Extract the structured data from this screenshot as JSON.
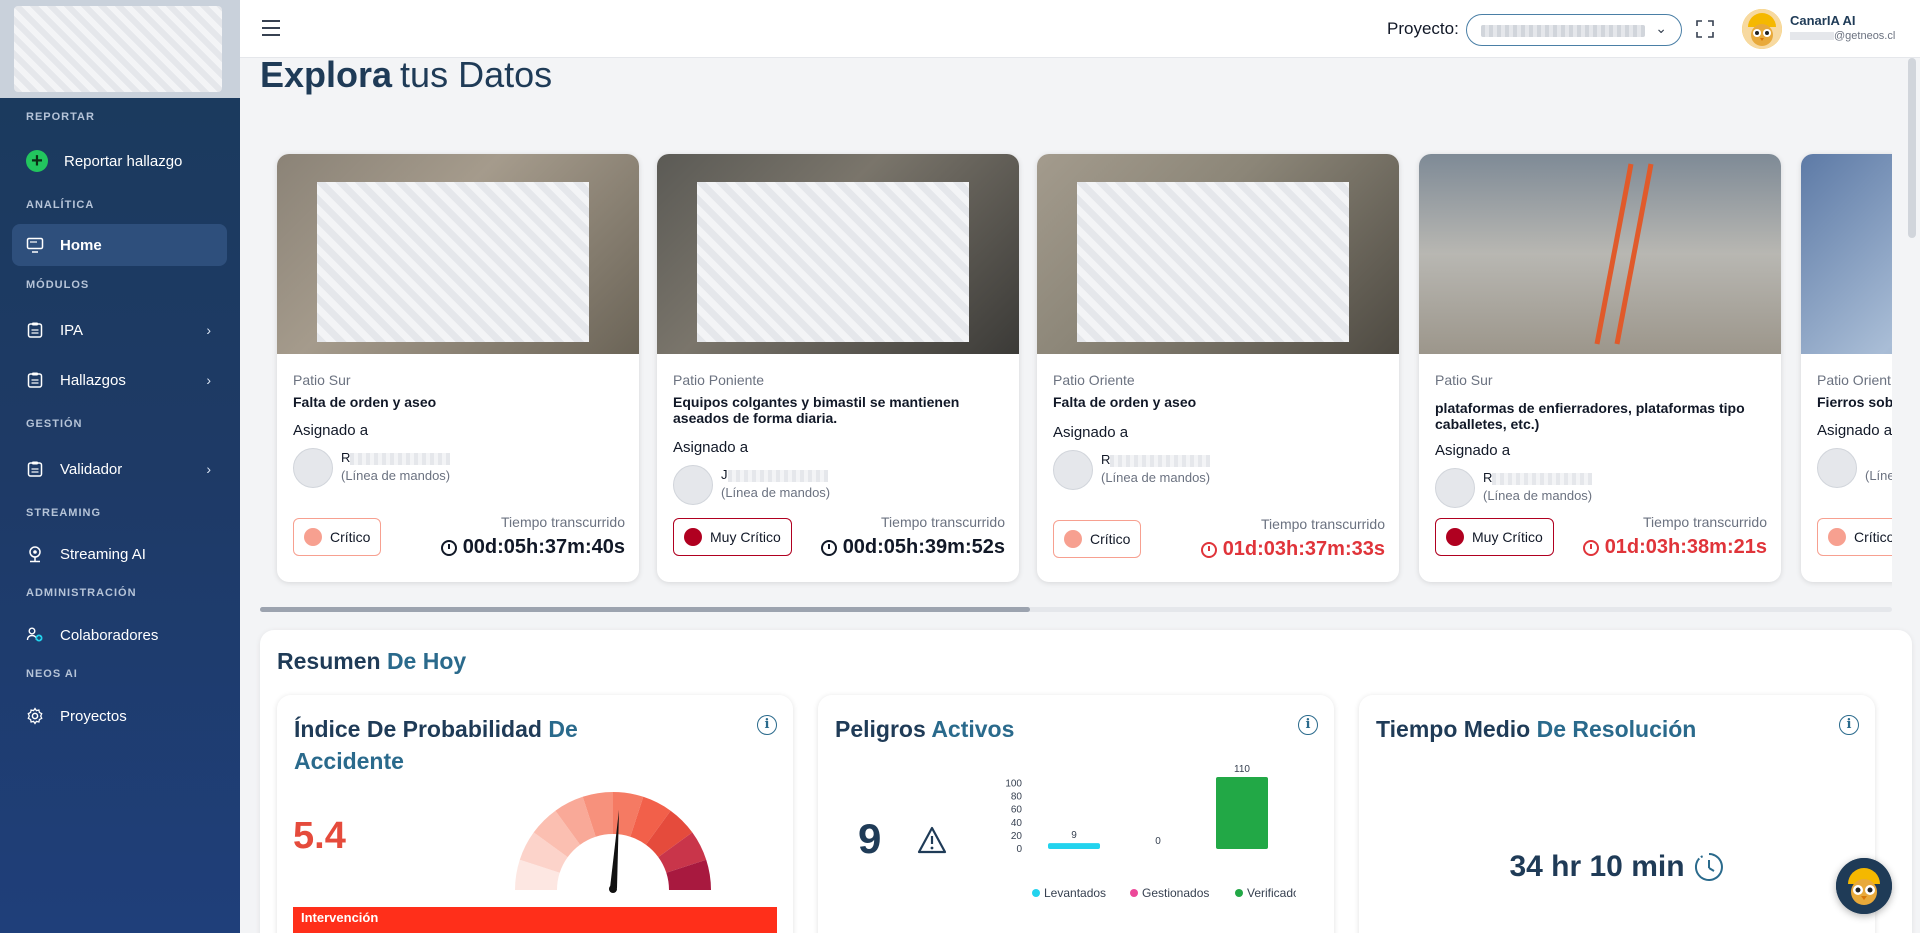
{
  "sidebar": {
    "sections": {
      "reportar": "REPORTAR",
      "analitica": "ANALÍTICA",
      "modulos": "MÓDULOS",
      "gestion": "GESTIÓN",
      "streaming": "STREAMING",
      "administracion": "ADMINISTRACIÓN",
      "neos_ai": "NEOS AI"
    },
    "items": {
      "reportar_hallazgo": "Reportar hallazgo",
      "home": "Home",
      "ipa": "IPA",
      "hallazgos": "Hallazgos",
      "validador": "Validador",
      "streaming_ai": "Streaming AI",
      "colaboradores": "Colaboradores",
      "proyectos": "Proyectos"
    }
  },
  "header": {
    "project_label": "Proyecto:",
    "user_name": "CanarIA AI",
    "user_email_suffix": "@getneos.cl"
  },
  "page": {
    "title_bold": "Explora",
    "title_rest": "tus Datos"
  },
  "cards": [
    {
      "location": "Patio Sur",
      "title": "Falta de orden y aseo",
      "assigned_label": "Asignado a",
      "person_initial": "R",
      "person_role": "(Línea de mandos)",
      "severity": "Crítico",
      "time_label": "Tiempo transcurrido",
      "time": "00d:05h:37m:40s"
    },
    {
      "location": "Patio Poniente",
      "title": "Equipos colgantes y bimastil se mantienen aseados de forma diaria.",
      "assigned_label": "Asignado a",
      "person_initial": "J",
      "person_role": "(Línea de mandos)",
      "severity": "Muy Crítico",
      "time_label": "Tiempo transcurrido",
      "time": "00d:05h:39m:52s"
    },
    {
      "location": "Patio Oriente",
      "title": "Falta de orden y aseo",
      "assigned_label": "Asignado a",
      "person_initial": "R",
      "person_role": "(Línea de mandos)",
      "severity": "Crítico",
      "time_label": "Tiempo transcurrido",
      "time": "01d:03h:37m:33s"
    },
    {
      "location": "Patio Sur",
      "title": "plataformas de enfierradores, plataformas tipo caballetes, etc.)",
      "assigned_label": "Asignado a",
      "person_initial": "R",
      "person_role": "(Línea de mandos)",
      "severity": "Muy Crítico",
      "time_label": "Tiempo transcurrido",
      "time": "01d:03h:38m:21s"
    },
    {
      "location": "Patio Orient",
      "title": "Fierros sob",
      "assigned_label": "Asignado a",
      "person_role": "(Líne",
      "severity": "Crítico"
    }
  ],
  "resumen": {
    "title_a": "Resumen",
    "title_b": "De Hoy",
    "probabilidad": {
      "title_a": "Índice De Probabilidad",
      "title_b": "De Accidente",
      "value": "5.4",
      "level": "Intervención"
    },
    "peligros": {
      "title_a": "Peligros",
      "title_b": "Activos",
      "count": "9"
    },
    "tiempo": {
      "title_a": "Tiempo Medio",
      "title_b": "De Resolución",
      "value": "34 hr 10 min"
    }
  },
  "chart_data": {
    "type": "bar",
    "categories": [
      "Levantados",
      "Gestionados",
      "Verificados"
    ],
    "values": [
      9,
      0,
      110
    ],
    "colors": [
      "#22d3ee",
      "#ec4899",
      "#22a846"
    ],
    "y_ticks": [
      0,
      20,
      40,
      60,
      80,
      100
    ],
    "ylim": [
      0,
      110
    ],
    "legend_position": "bottom"
  },
  "colors": {
    "critico": "#f7a090",
    "muy_critico": "#b00020",
    "accent": "#2a6a8c",
    "sidebar": "#1e3a66"
  }
}
